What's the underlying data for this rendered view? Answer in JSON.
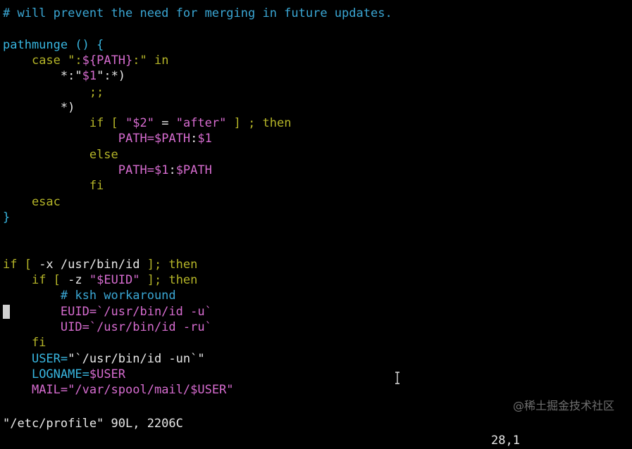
{
  "colors": {
    "background": "#000000",
    "comment": "#3aa6d3",
    "keyword": "#b5b528",
    "string": "#d76cd0",
    "plain": "#e8e8e8",
    "function": "#38b6e0",
    "cursor": "#d0d0d0"
  },
  "lines": [
    [
      {
        "t": "# will prevent the need for merging in future updates.",
        "c": "comment"
      }
    ],
    [],
    [
      {
        "t": "pathmunge () {",
        "c": "function"
      }
    ],
    [
      {
        "t": "    ",
        "c": "plain"
      },
      {
        "t": "case",
        "c": "keyword"
      },
      {
        "t": " \":",
        "c": "keyword"
      },
      {
        "t": "${PATH}",
        "c": "string"
      },
      {
        "t": ":\" ",
        "c": "keyword"
      },
      {
        "t": "in",
        "c": "keyword"
      }
    ],
    [
      {
        "t": "        ",
        "c": "plain"
      },
      {
        "t": "*:\"",
        "c": "plain"
      },
      {
        "t": "$1",
        "c": "string"
      },
      {
        "t": "\":*)",
        "c": "plain"
      }
    ],
    [
      {
        "t": "            ;;",
        "c": "keyword"
      }
    ],
    [
      {
        "t": "        *)",
        "c": "plain"
      }
    ],
    [
      {
        "t": "            ",
        "c": "plain"
      },
      {
        "t": "if [ ",
        "c": "keyword"
      },
      {
        "t": "\"",
        "c": "string"
      },
      {
        "t": "$2",
        "c": "string"
      },
      {
        "t": "\"",
        "c": "string"
      },
      {
        "t": " = ",
        "c": "plain"
      },
      {
        "t": "\"after\"",
        "c": "string"
      },
      {
        "t": " ] ; then",
        "c": "keyword"
      }
    ],
    [
      {
        "t": "                ",
        "c": "plain"
      },
      {
        "t": "PATH=",
        "c": "string"
      },
      {
        "t": "$PATH",
        "c": "string"
      },
      {
        "t": ":",
        "c": "plain"
      },
      {
        "t": "$1",
        "c": "string"
      }
    ],
    [
      {
        "t": "            else",
        "c": "keyword"
      }
    ],
    [
      {
        "t": "                ",
        "c": "plain"
      },
      {
        "t": "PATH=",
        "c": "string"
      },
      {
        "t": "$1",
        "c": "string"
      },
      {
        "t": ":",
        "c": "plain"
      },
      {
        "t": "$PATH",
        "c": "string"
      }
    ],
    [
      {
        "t": "            fi",
        "c": "keyword"
      }
    ],
    [
      {
        "t": "    esac",
        "c": "keyword"
      }
    ],
    [
      {
        "t": "}",
        "c": "function"
      }
    ],
    [],
    [],
    [
      {
        "t": "if [ ",
        "c": "keyword"
      },
      {
        "t": "-x /usr/bin/id",
        "c": "plain"
      },
      {
        "t": " ]; then",
        "c": "keyword"
      }
    ],
    [
      {
        "t": "    ",
        "c": "plain"
      },
      {
        "t": "if [ ",
        "c": "keyword"
      },
      {
        "t": "-z ",
        "c": "plain"
      },
      {
        "t": "\"$EUID\"",
        "c": "string"
      },
      {
        "t": " ]; then",
        "c": "keyword"
      }
    ],
    [
      {
        "t": "        ",
        "c": "plain"
      },
      {
        "t": "# ksh workaround",
        "c": "comment"
      }
    ],
    [
      {
        "t": "        ",
        "c": "plain"
      },
      {
        "t": "EUID=`/usr/bin/id -u`",
        "c": "string"
      }
    ],
    [
      {
        "t": "        ",
        "c": "plain"
      },
      {
        "t": "UID=`/usr/bin/id -ru`",
        "c": "string"
      }
    ],
    [
      {
        "t": "    fi",
        "c": "keyword"
      }
    ],
    [
      {
        "t": "    ",
        "c": "plain"
      },
      {
        "t": "USER=",
        "c": "function"
      },
      {
        "t": "\"`/usr/bin/id -un`\"",
        "c": "plain"
      }
    ],
    [
      {
        "t": "    ",
        "c": "plain"
      },
      {
        "t": "LOGNAME=",
        "c": "function"
      },
      {
        "t": "$USER",
        "c": "string"
      }
    ],
    [
      {
        "t": "    ",
        "c": "plain"
      },
      {
        "t": "MAIL=",
        "c": "string"
      },
      {
        "t": "\"/var/spool/mail/$USER\"",
        "c": "string"
      }
    ]
  ],
  "status": {
    "file_info": "\"/etc/profile\" 90L, 2206C",
    "position": "28,1"
  },
  "watermark": "@稀土掘金技术社区"
}
